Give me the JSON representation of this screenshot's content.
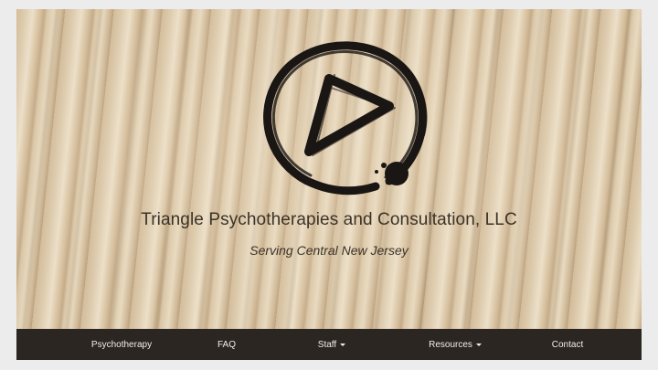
{
  "site": {
    "title": "Triangle Psychotherapies and Consultation, LLC",
    "tagline": "Serving Central New Jersey",
    "logo_icon": "triangle-ink-circle-logo"
  },
  "nav": {
    "items": [
      {
        "label": "Psychotherapy",
        "dropdown": false
      },
      {
        "label": "FAQ",
        "dropdown": false
      },
      {
        "label": "Staff",
        "dropdown": true
      },
      {
        "label": "Resources",
        "dropdown": true
      },
      {
        "label": "Contact",
        "dropdown": false
      }
    ]
  },
  "colors": {
    "navbar_bg": "#2c2622",
    "nav_text": "#f1ede7",
    "title_text": "#3b3329",
    "logo_ink": "#1a1614"
  }
}
